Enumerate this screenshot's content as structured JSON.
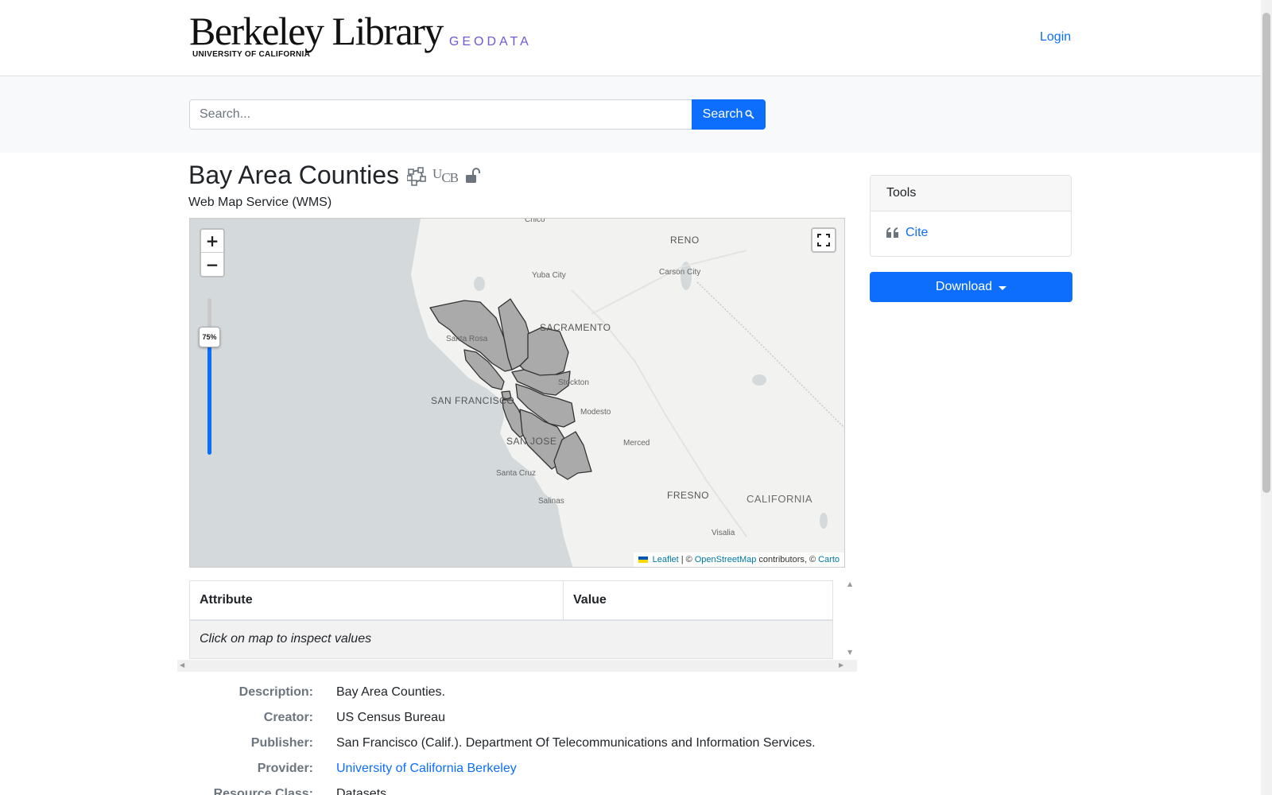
{
  "header": {
    "logo_text": "Berkeley Library",
    "logo_subtext": "UNIVERSITY OF CALIFORNIA",
    "logo_geodata": "GEODATA",
    "login_label": "Login"
  },
  "search": {
    "placeholder": "Search...",
    "button_label": "Search"
  },
  "record": {
    "title": "Bay Area Counties",
    "service_type": "Web Map Service (WMS)",
    "institution_mark_main": "U",
    "institution_mark_sub1": "C",
    "institution_mark_sub2": "B",
    "icons": [
      "polygon-icon",
      "institution-ucb-icon",
      "public-unlock-icon"
    ]
  },
  "map": {
    "opacity_label": "75%",
    "opacity_value": 0.75,
    "zoom_in": "+",
    "zoom_out": "−",
    "labels": {
      "chico": "Chico",
      "reno": "RENO",
      "carson": "Carson City",
      "yuba": "Yuba City",
      "sacramento": "SACRAMENTO",
      "santarosa": "Santa Rosa",
      "stockton": "Stockton",
      "sf": "SAN FRANCISCO",
      "modesto": "Modesto",
      "sanjose": "SAN JOSE",
      "merced": "Merced",
      "santacruz": "Santa Cruz",
      "fresno": "FRESNO",
      "california": "CALIFORNIA",
      "salinas": "Salinas",
      "visalia": "Visalia"
    },
    "attribution": {
      "leaflet": "Leaflet",
      "sep": "| ©",
      "osm": "OpenStreetMap",
      "contributors": "contributors, ©",
      "carto": "Carto"
    },
    "colors": {
      "water": "#d4dadc",
      "land": "#f2f2f0",
      "polygon_fill": "#aaaaaa",
      "polygon_stroke": "#333333"
    }
  },
  "attribute_table": {
    "col_attribute": "Attribute",
    "col_value": "Value",
    "empty_message": "Click on map to inspect values"
  },
  "metadata": {
    "description_label": "Description:",
    "description_value": "Bay Area Counties.",
    "creator_label": "Creator:",
    "creator_value": "US Census Bureau",
    "publisher_label": "Publisher:",
    "publisher_value": "San Francisco (Calif.). Department Of Telecommunications and Information Services.",
    "provider_label": "Provider:",
    "provider_value": "University of California Berkeley",
    "resource_class_label": "Resource Class:",
    "resource_class_value": "Datasets"
  },
  "tools": {
    "heading": "Tools",
    "cite_label": "Cite",
    "download_label": "Download"
  },
  "colors": {
    "primary": "#0d6efd",
    "geodata_accent": "#6b5bd6",
    "label_gray": "#6c757d"
  }
}
